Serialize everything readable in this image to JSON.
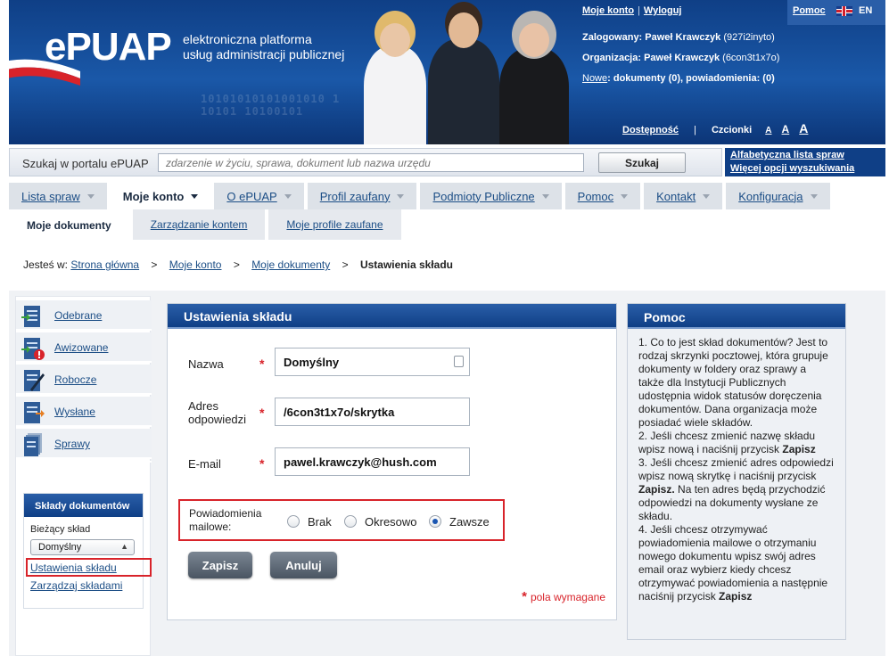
{
  "header": {
    "logo": "ePUAP",
    "tagline_line1": "elektroniczna platforma",
    "tagline_line2": "usług administracji publicznej",
    "binary_line1": "10101010101001010 1",
    "binary_line2": "10101 10100101"
  },
  "user_panel": {
    "moje_konto": "Moje konto",
    "separator": "|",
    "wyloguj": "Wyloguj",
    "pomoc": "Pomoc",
    "lang": "EN",
    "logged_label": "Zalogowany:",
    "logged_name": "Paweł Krawczyk",
    "logged_id": "(927i2inyto)",
    "org_label": "Organizacja:",
    "org_name": "Paweł Krawczyk",
    "org_id": "(6con3t1x7o)",
    "new_label": "Nowe",
    "new_text": ": dokumenty (0), powiadomienia: (0)",
    "accessibility": "Dostępność",
    "fonts_label": "Czcionki",
    "font_small": "A",
    "font_medium": "A",
    "font_large": "A"
  },
  "search": {
    "label": "Szukaj w portalu ePUAP",
    "placeholder": "zdarzenie w życiu, sprawa, dokument lub nazwa urzędu",
    "button": "Szukaj",
    "link_alpha": "Alfabetyczna lista spraw",
    "link_more": "Więcej opcji wyszukiwania"
  },
  "nav": {
    "tabs": [
      {
        "label": "Lista spraw"
      },
      {
        "label": "Moje konto"
      },
      {
        "label": "O ePUAP"
      },
      {
        "label": "Profil zaufany"
      },
      {
        "label": "Podmioty Publiczne"
      },
      {
        "label": "Pomoc"
      },
      {
        "label": "Kontakt"
      },
      {
        "label": "Konfiguracja"
      }
    ],
    "subtabs": [
      {
        "label": "Moje dokumenty"
      },
      {
        "label": "Zarządzanie kontem"
      },
      {
        "label": "Moje profile zaufane"
      }
    ]
  },
  "breadcrumb": {
    "prefix": "Jesteś w:",
    "sep": ">",
    "items": [
      "Strona główna",
      "Moje konto",
      "Moje dokumenty"
    ],
    "current": "Ustawienia składu"
  },
  "sidebar": {
    "folders": [
      {
        "label": "Odebrane",
        "icon": "inbox-icon"
      },
      {
        "label": "Awizowane",
        "icon": "notice-icon"
      },
      {
        "label": "Robocze",
        "icon": "draft-icon"
      },
      {
        "label": "Wysłane",
        "icon": "sent-icon"
      },
      {
        "label": "Sprawy",
        "icon": "cases-icon"
      }
    ],
    "sklady": {
      "title": "Składy dokumentów",
      "current_label": "Bieżący skład",
      "selected": "Domyślny",
      "link_settings": "Ustawienia składu",
      "link_manage": "Zarządzaj składami"
    }
  },
  "form": {
    "title": "Ustawienia składu",
    "name_label": "Nazwa",
    "name_value": "Domyślny",
    "address_label_1": "Adres",
    "address_label_2": "odpowiedzi",
    "address_value": "/6con3t1x7o/skrytka",
    "email_label": "E-mail",
    "email_value": "pawel.krawczyk@hush.com",
    "required_mark": "*",
    "notify_label_1": "Powiadomienia",
    "notify_label_2": "mailowe:",
    "notify_options": [
      "Brak",
      "Okresowo",
      "Zawsze"
    ],
    "notify_selected": "Zawsze",
    "save_button": "Zapisz",
    "cancel_button": "Anuluj",
    "required_note": "pola wymagane"
  },
  "help": {
    "title": "Pomoc",
    "p1": "1. Co to jest skład dokumentów? Jest to rodzaj skrzynki pocztowej, która grupuje dokumenty w foldery oraz sprawy a także dla Instytucji Publicznych udostępnia widok statusów doręczenia dokumentów. Dana organizacja może posiadać wiele składów.",
    "p2a": "2. Jeśli chcesz zmienić nazwę składu wpisz nową i naciśnij przycisk ",
    "p2b": "Zapisz",
    "p3a": "3. Jeśli chcesz zmienić adres odpowiedzi wpisz nową skrytkę i naciśnij przycisk ",
    "p3b": "Zapisz.",
    "p3c": " Na ten adres będą przychodzić odpowiedzi na dokumenty wysłane ze składu.",
    "p4a": "4. Jeśli chcesz otrzymywać powiadomienia mailowe o otrzymaniu nowego dokumentu wpisz swój adres email oraz wybierz kiedy chcesz otrzymywać powiadomienia a następnie naciśnij przycisk ",
    "p4b": "Zapisz"
  },
  "colors": {
    "brand_blue": "#0f3f86",
    "link": "#1c4e86",
    "highlight_red": "#d8232a"
  }
}
